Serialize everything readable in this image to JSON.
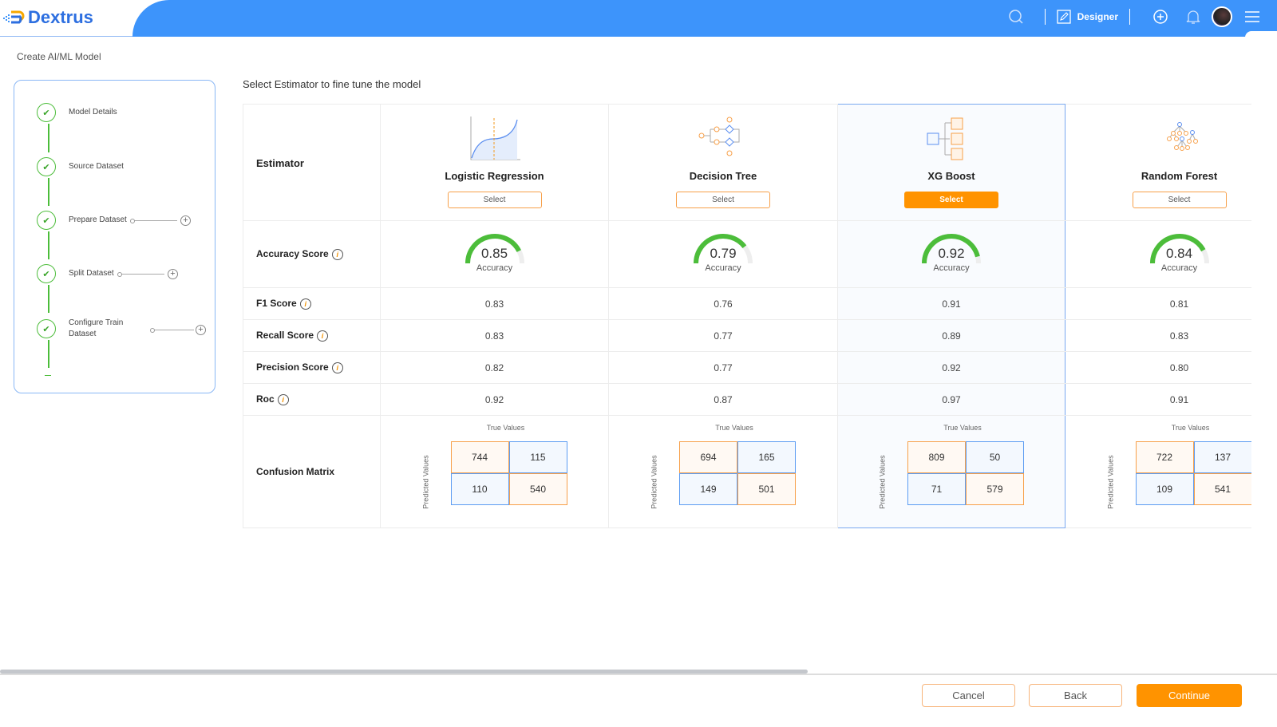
{
  "header": {
    "brand": "Dextrus",
    "mode_label": "Designer"
  },
  "breadcrumb": "Create AI/ML Model",
  "steps": [
    {
      "label": "Model Details"
    },
    {
      "label": "Source Dataset"
    },
    {
      "label": "Prepare Dataset"
    },
    {
      "label": "Split Dataset"
    },
    {
      "label": "Configure Train Dataset"
    }
  ],
  "page_title": "Select Estimator to fine tune the model",
  "row_labels": {
    "estimator": "Estimator",
    "accuracy": "Accuracy Score",
    "f1": "F1 Score",
    "recall": "Recall Score",
    "precision": "Precision Score",
    "roc": "Roc",
    "confusion": "Confusion Matrix"
  },
  "info_glyph": "i",
  "accuracy_caption": "Accuracy",
  "cm_true_label": "True Values",
  "cm_pred_label": "Predicted Values",
  "select_label": "Select",
  "models": [
    {
      "name": "Logistic Regression",
      "icon": "logistic-curve",
      "accuracy": "0.85",
      "accuracy_value": 0.85,
      "f1": "0.83",
      "recall": "0.83",
      "precision": "0.82",
      "roc": "0.92",
      "cm": [
        "744",
        "115",
        "110",
        "540"
      ],
      "selected": false
    },
    {
      "name": "Decision Tree",
      "icon": "decision-tree",
      "accuracy": "0.79",
      "accuracy_value": 0.79,
      "f1": "0.76",
      "recall": "0.77",
      "precision": "0.77",
      "roc": "0.87",
      "cm": [
        "694",
        "165",
        "149",
        "501"
      ],
      "selected": false
    },
    {
      "name": "XG Boost",
      "icon": "xgboost",
      "accuracy": "0.92",
      "accuracy_value": 0.92,
      "f1": "0.91",
      "recall": "0.89",
      "precision": "0.92",
      "roc": "0.97",
      "cm": [
        "809",
        "50",
        "71",
        "579"
      ],
      "selected": true
    },
    {
      "name": "Random Forest",
      "icon": "random-forest",
      "accuracy": "0.84",
      "accuracy_value": 0.84,
      "f1": "0.81",
      "recall": "0.83",
      "precision": "0.80",
      "roc": "0.91",
      "cm": [
        "722",
        "137",
        "109",
        "541"
      ],
      "selected": false
    }
  ],
  "footer": {
    "cancel": "Cancel",
    "back": "Back",
    "continue": "Continue"
  },
  "colors": {
    "primary": "#3d94fb",
    "accent": "#ff9300",
    "success": "#4cbd3a"
  }
}
